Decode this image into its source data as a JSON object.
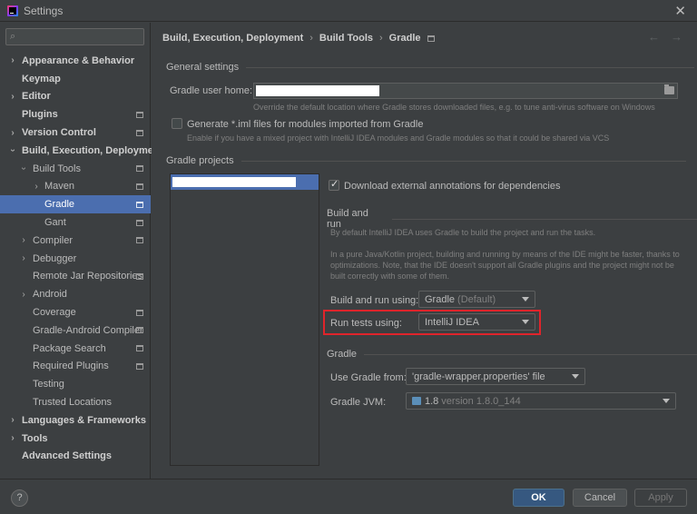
{
  "window": {
    "title": "Settings"
  },
  "search": {
    "placeholder": "",
    "value": ""
  },
  "sidebar": {
    "items": [
      {
        "label": "Appearance & Behavior"
      },
      {
        "label": "Keymap"
      },
      {
        "label": "Editor"
      },
      {
        "label": "Plugins"
      },
      {
        "label": "Version Control"
      },
      {
        "label": "Build, Execution, Deployment"
      },
      {
        "label": "Build Tools"
      },
      {
        "label": "Maven"
      },
      {
        "label": "Gradle"
      },
      {
        "label": "Gant"
      },
      {
        "label": "Compiler"
      },
      {
        "label": "Debugger"
      },
      {
        "label": "Remote Jar Repositories"
      },
      {
        "label": "Android"
      },
      {
        "label": "Coverage"
      },
      {
        "label": "Gradle-Android Compiler"
      },
      {
        "label": "Package Search"
      },
      {
        "label": "Required Plugins"
      },
      {
        "label": "Testing"
      },
      {
        "label": "Trusted Locations"
      },
      {
        "label": "Languages & Frameworks"
      },
      {
        "label": "Tools"
      },
      {
        "label": "Advanced Settings"
      }
    ]
  },
  "breadcrumb": {
    "part1": "Build, Execution, Deployment",
    "part2": "Build Tools",
    "part3": "Gradle",
    "sep": "›"
  },
  "general": {
    "title": "General settings",
    "user_home_label": "Gradle user home:",
    "user_home_hint": "Override the default location where Gradle stores downloaded files, e.g. to tune anti-virus software on Windows",
    "iml_label": "Generate *.iml files for modules imported from Gradle",
    "iml_hint": "Enable if you have a mixed project with IntelliJ IDEA modules and Gradle modules so that it could be shared via VCS"
  },
  "projects": {
    "title": "Gradle projects",
    "download_annotations_label": "Download external annotations for dependencies",
    "build_run_title": "Build and run",
    "build_run_hint1": "By default IntelliJ IDEA uses Gradle to build the project and run the tasks.",
    "build_run_hint2": "In a pure Java/Kotlin project, building and running by means of the IDE might be faster, thanks to optimizations. Note, that the IDE doesn't support all Gradle plugins and the project might not be built correctly with some of them.",
    "build_run_using_label": "Build and run using:",
    "build_run_using_value": "Gradle",
    "build_run_using_suffix": "(Default)",
    "run_tests_label": "Run tests using:",
    "run_tests_value": "IntelliJ IDEA",
    "gradle_title": "Gradle",
    "use_gradle_from_label": "Use Gradle from:",
    "use_gradle_from_value": "'gradle-wrapper.properties' file",
    "gradle_jvm_label": "Gradle JVM:",
    "gradle_jvm_value": "1.8",
    "gradle_jvm_detail": "version 1.8.0_144"
  },
  "footer": {
    "help": "?",
    "ok": "OK",
    "cancel": "Cancel",
    "apply": "Apply"
  },
  "colors": {
    "background": "#3c3f41",
    "selection": "#4b6eaf",
    "highlight": "#e0242b",
    "ok_button": "#365880"
  }
}
